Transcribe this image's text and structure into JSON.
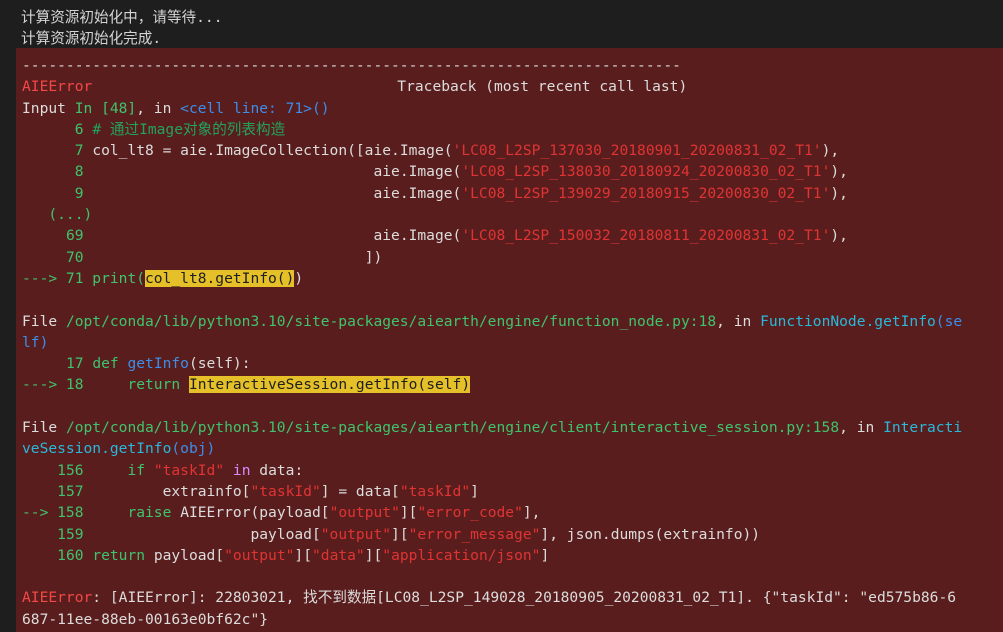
{
  "stdout": {
    "line1": "计算资源初始化中，请等待...",
    "line2": "计算资源初始化完成."
  },
  "error": {
    "separator": "---------------------------------------------------------------------------",
    "name": "AIEError",
    "traceback_header": "Traceback (most recent call last)",
    "input_prefix": "Input ",
    "input_cell": "In [48]",
    "input_mid": ", in ",
    "input_loc": "<cell line: 71>",
    "input_suffix": "()",
    "frame1": {
      "l6_num": "6",
      "l6_code": "# 通过Image对象的列表构造",
      "l7_num": "7",
      "l7_a": "col_lt8 = aie.ImageCollection([aie.Image(",
      "l7_str": "'LC08_L2SP_137030_20180901_20200831_02_T1'",
      "l7_b": "),",
      "l8_num": "8",
      "l8_a": "aie.Image(",
      "l8_str": "'LC08_L2SP_138030_20180924_20200830_02_T1'",
      "l8_b": "),",
      "l9_num": "9",
      "l9_a": "aie.Image(",
      "l9_str": "'LC08_L2SP_139029_20180915_20200830_02_T1'",
      "l9_b": "),",
      "ellipsis": "(...)",
      "l69_num": "69",
      "l69_a": "aie.Image(",
      "l69_str": "'LC08_L2SP_150032_20180811_20200831_02_T1'",
      "l69_b": "),",
      "l70_num": "70",
      "l70_code": "])",
      "arrow": "---> 71 ",
      "l71_print": "print(",
      "l71_hl": "col_lt8.getInfo()",
      "l71_end": ")"
    },
    "frame2": {
      "file_prefix": "File ",
      "path": "/opt/conda/lib/python3.10/site-packages/aiearth/engine/function_node.py:18",
      "in_word": ", in ",
      "func": "FunctionNode.getInfo",
      "func_args_a": "(se",
      "func_args_b": "lf)",
      "l17_num": "17",
      "l17_def": "def",
      "l17_name": "getInfo",
      "l17_args": "(self):",
      "arrow": "---> 18 ",
      "l18_ret": "return",
      "l18_hl": "InteractiveSession.getInfo(self)"
    },
    "frame3": {
      "file_prefix": "File ",
      "path": "/opt/conda/lib/python3.10/site-packages/aiearth/engine/client/interactive_session.py:158",
      "in_word": ", in ",
      "func_a": "Interacti",
      "func_b": "veSession.getInfo",
      "func_args": "(obj)",
      "l156_num": "156",
      "l156_if": "if",
      "l156_str": "\"taskId\"",
      "l156_in": "in",
      "l156_end": "data:",
      "l157_num": "157",
      "l157_a": "extrainfo[",
      "l157_s1": "\"taskId\"",
      "l157_b": "] = data[",
      "l157_s2": "\"taskId\"",
      "l157_c": "]",
      "arrow": "--> 158 ",
      "l158_raise": "raise",
      "l158_a": "AIEError(payload[",
      "l158_s1": "\"output\"",
      "l158_b": "][",
      "l158_s2": "\"error_code\"",
      "l158_c": "],",
      "l159_num": "159",
      "l159_a": "payload[",
      "l159_s1": "\"output\"",
      "l159_b": "][",
      "l159_s2": "\"error_message\"",
      "l159_c": "], json.dumps(extrainfo))",
      "l160_num": "160",
      "l160_ret": "return",
      "l160_a": "payload[",
      "l160_s1": "\"output\"",
      "l160_b": "][",
      "l160_s2": "\"data\"",
      "l160_c": "][",
      "l160_s3": "\"application/json\"",
      "l160_d": "]"
    },
    "final": {
      "name": "AIEError",
      "msg_a": ": [AIEError]: 22803021, 找不到数据[LC08_L2SP_149028_20180905_20200831_02_T1]. {\"taskId\": \"ed575b86-6",
      "msg_b": "687-11ee-88eb-00163e0bf62c\"}"
    }
  }
}
